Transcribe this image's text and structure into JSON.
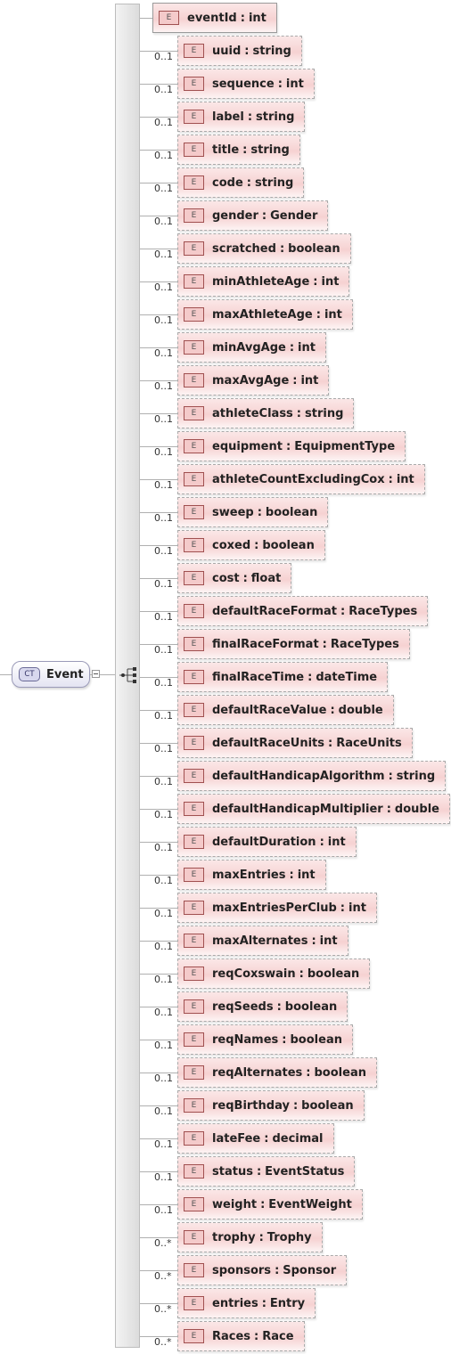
{
  "complex_type": {
    "badge": "CT",
    "name": "Event"
  },
  "elements": [
    {
      "badge": "E",
      "name": "eventId",
      "type": "int",
      "multiplicity": ""
    },
    {
      "badge": "E",
      "name": "uuid",
      "type": "string",
      "multiplicity": "0..1"
    },
    {
      "badge": "E",
      "name": "sequence",
      "type": "int",
      "multiplicity": "0..1"
    },
    {
      "badge": "E",
      "name": "label",
      "type": "string",
      "multiplicity": "0..1"
    },
    {
      "badge": "E",
      "name": "title",
      "type": "string",
      "multiplicity": "0..1"
    },
    {
      "badge": "E",
      "name": "code",
      "type": "string",
      "multiplicity": "0..1"
    },
    {
      "badge": "E",
      "name": "gender",
      "type": "Gender",
      "multiplicity": "0..1"
    },
    {
      "badge": "E",
      "name": "scratched",
      "type": "boolean",
      "multiplicity": "0..1"
    },
    {
      "badge": "E",
      "name": "minAthleteAge",
      "type": "int",
      "multiplicity": "0..1"
    },
    {
      "badge": "E",
      "name": "maxAthleteAge",
      "type": "int",
      "multiplicity": "0..1"
    },
    {
      "badge": "E",
      "name": "minAvgAge",
      "type": "int",
      "multiplicity": "0..1"
    },
    {
      "badge": "E",
      "name": "maxAvgAge",
      "type": "int",
      "multiplicity": "0..1"
    },
    {
      "badge": "E",
      "name": "athleteClass",
      "type": "string",
      "multiplicity": "0..1"
    },
    {
      "badge": "E",
      "name": "equipment",
      "type": "EquipmentType",
      "multiplicity": "0..1"
    },
    {
      "badge": "E",
      "name": "athleteCountExcludingCox",
      "type": "int",
      "multiplicity": "0..1"
    },
    {
      "badge": "E",
      "name": "sweep",
      "type": "boolean",
      "multiplicity": "0..1"
    },
    {
      "badge": "E",
      "name": "coxed",
      "type": "boolean",
      "multiplicity": "0..1"
    },
    {
      "badge": "E",
      "name": "cost",
      "type": "float",
      "multiplicity": "0..1"
    },
    {
      "badge": "E",
      "name": "defaultRaceFormat",
      "type": "RaceTypes",
      "multiplicity": "0..1"
    },
    {
      "badge": "E",
      "name": "finalRaceFormat",
      "type": "RaceTypes",
      "multiplicity": "0..1"
    },
    {
      "badge": "E",
      "name": "finalRaceTime",
      "type": "dateTime",
      "multiplicity": "0..1"
    },
    {
      "badge": "E",
      "name": "defaultRaceValue",
      "type": "double",
      "multiplicity": "0..1"
    },
    {
      "badge": "E",
      "name": "defaultRaceUnits",
      "type": "RaceUnits",
      "multiplicity": "0..1"
    },
    {
      "badge": "E",
      "name": "defaultHandicapAlgorithm",
      "type": "string",
      "multiplicity": "0..1"
    },
    {
      "badge": "E",
      "name": "defaultHandicapMultiplier",
      "type": "double",
      "multiplicity": "0..1"
    },
    {
      "badge": "E",
      "name": "defaultDuration",
      "type": "int",
      "multiplicity": "0..1"
    },
    {
      "badge": "E",
      "name": "maxEntries",
      "type": "int",
      "multiplicity": "0..1"
    },
    {
      "badge": "E",
      "name": "maxEntriesPerClub",
      "type": "int",
      "multiplicity": "0..1"
    },
    {
      "badge": "E",
      "name": "maxAlternates",
      "type": "int",
      "multiplicity": "0..1"
    },
    {
      "badge": "E",
      "name": "reqCoxswain",
      "type": "boolean",
      "multiplicity": "0..1"
    },
    {
      "badge": "E",
      "name": "reqSeeds",
      "type": "boolean",
      "multiplicity": "0..1"
    },
    {
      "badge": "E",
      "name": "reqNames",
      "type": "boolean",
      "multiplicity": "0..1"
    },
    {
      "badge": "E",
      "name": "reqAlternates",
      "type": "boolean",
      "multiplicity": "0..1"
    },
    {
      "badge": "E",
      "name": "reqBirthday",
      "type": "boolean",
      "multiplicity": "0..1"
    },
    {
      "badge": "E",
      "name": "lateFee",
      "type": "decimal",
      "multiplicity": "0..1"
    },
    {
      "badge": "E",
      "name": "status",
      "type": "EventStatus",
      "multiplicity": "0..1"
    },
    {
      "badge": "E",
      "name": "weight",
      "type": "EventWeight",
      "multiplicity": "0..1"
    },
    {
      "badge": "E",
      "name": "trophy",
      "type": "Trophy",
      "multiplicity": "0..*"
    },
    {
      "badge": "E",
      "name": "sponsors",
      "type": "Sponsor",
      "multiplicity": "0..*"
    },
    {
      "badge": "E",
      "name": "entries",
      "type": "Entry",
      "multiplicity": "0..*"
    },
    {
      "badge": "E",
      "name": "Races",
      "type": "Race",
      "multiplicity": "0..*"
    }
  ],
  "separator": ":"
}
